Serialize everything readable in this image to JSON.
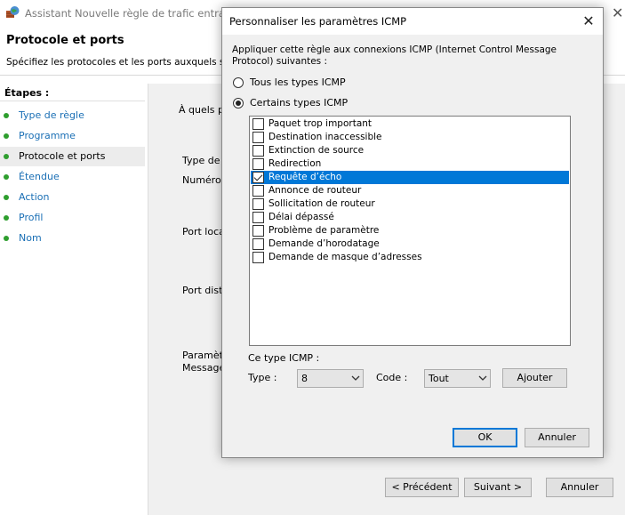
{
  "wizard": {
    "title": "Assistant Nouvelle règle de trafic entrant",
    "header_title": "Protocole et ports",
    "header_desc": "Spécifiez les protocoles et les ports auxquels s’appli",
    "steps_title": "Étapes :",
    "steps": [
      {
        "label": "Type de règle",
        "state": "link"
      },
      {
        "label": "Programme",
        "state": "link"
      },
      {
        "label": "Protocole et ports",
        "state": "current"
      },
      {
        "label": "Étendue",
        "state": "link"
      },
      {
        "label": "Action",
        "state": "link"
      },
      {
        "label": "Profil",
        "state": "link"
      },
      {
        "label": "Nom",
        "state": "link"
      }
    ],
    "content_labels": {
      "which_ports": "À quels po",
      "protocol_type": "Type de p",
      "protocol_number": "Numéro d",
      "local_port": "Port local",
      "remote_port": "Port dista",
      "params_1": "Paramètre",
      "params_2": "Message"
    },
    "buttons": {
      "previous": "< Précédent",
      "next": "Suivant >",
      "cancel": "Annuler"
    },
    "step_dot_color": "#2e9e2e",
    "link_color": "#1a6fb5"
  },
  "dialog": {
    "title": "Personnaliser les paramètres ICMP",
    "description": "Appliquer cette règle aux connexions ICMP (Internet Control Message Protocol) suivantes :",
    "radio_all": {
      "label": "Tous les types ICMP",
      "checked": false
    },
    "radio_specific": {
      "label": "Certains types ICMP",
      "checked": true
    },
    "types": [
      {
        "label": "Paquet trop important",
        "checked": false,
        "selected": false
      },
      {
        "label": "Destination inaccessible",
        "checked": false,
        "selected": false
      },
      {
        "label": "Extinction de source",
        "checked": false,
        "selected": false
      },
      {
        "label": "Redirection",
        "checked": false,
        "selected": false
      },
      {
        "label": "Requête d’écho",
        "checked": true,
        "selected": true
      },
      {
        "label": "Annonce de routeur",
        "checked": false,
        "selected": false
      },
      {
        "label": "Sollicitation de routeur",
        "checked": false,
        "selected": false
      },
      {
        "label": "Délai dépassé",
        "checked": false,
        "selected": false
      },
      {
        "label": "Problème de paramètre",
        "checked": false,
        "selected": false
      },
      {
        "label": "Demande d’horodatage",
        "checked": false,
        "selected": false
      },
      {
        "label": "Demande de masque d’adresses",
        "checked": false,
        "selected": false
      }
    ],
    "this_type_label": "Ce type ICMP :",
    "type_label": "Type :",
    "type_value": "8",
    "code_label": "Code :",
    "code_value": "Tout",
    "add_button": "Ajouter",
    "ok_button": "OK",
    "cancel_button": "Annuler",
    "selection_color": "#0078d7"
  }
}
